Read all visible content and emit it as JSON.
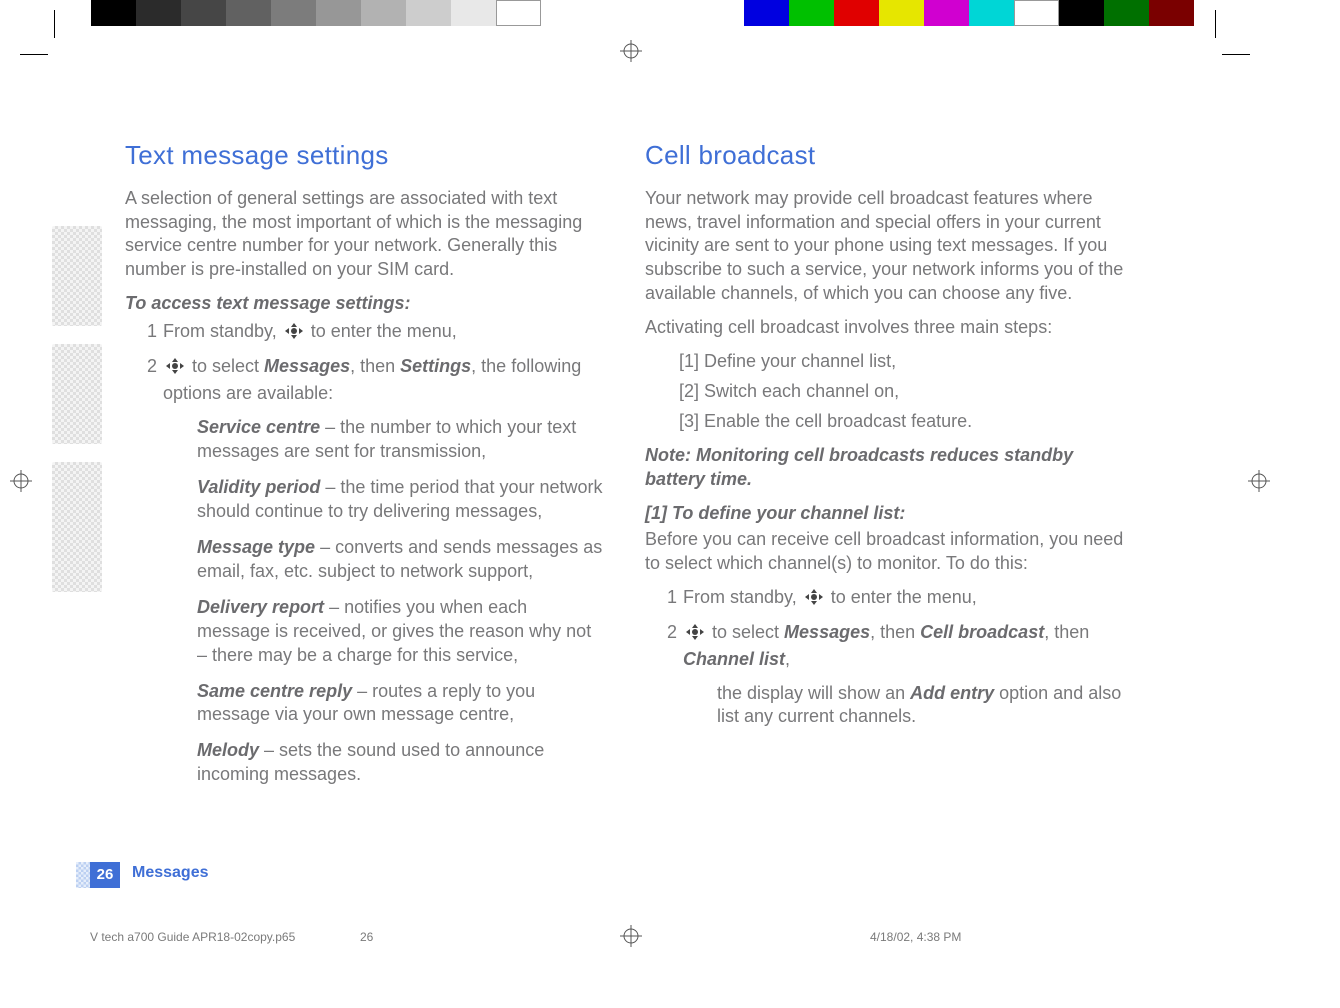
{
  "left": {
    "heading": "Text message settings",
    "intro": "A selection of general settings are associated with text messaging, the most important of which is the messaging service centre number for your network. Generally this number is pre-installed on your SIM card.",
    "access_label": "To access text message settings:",
    "step1_a": "From standby, ",
    "step1_b": " to enter the menu,",
    "step2_a": " to select ",
    "step2_m": "Messages",
    "step2_b": ", then ",
    "step2_s": "Settings",
    "step2_c": ", the following options are available:",
    "opts": [
      {
        "term": "Service centre",
        "desc": " – the number to which your text messages are sent for transmission,"
      },
      {
        "term": "Validity period",
        "desc": " – the time period that your network should continue to try delivering messages,"
      },
      {
        "term": "Message type",
        "desc": " – converts and sends messages as email, fax, etc. subject to network support,"
      },
      {
        "term": "Delivery report",
        "desc": " – notifies you when each message is received, or gives the reason why not – there may be a charge for this service,"
      },
      {
        "term": "Same centre reply",
        "desc": " – routes a reply to you message via your own message centre,"
      },
      {
        "term": "Melody",
        "desc": " – sets the sound used to announce incoming messages."
      }
    ]
  },
  "right": {
    "heading": "Cell broadcast",
    "intro": "Your network may provide cell broadcast features where news, travel information and special offers in your current vicinity are sent to your phone using text messages. If you subscribe to such a service, your network informs you of the available channels, of which you can choose any five.",
    "activating": "Activating cell broadcast involves three main steps:",
    "mains": [
      "[1] Define your channel list,",
      "[2] Switch each channel on,",
      "[3] Enable the cell broadcast feature."
    ],
    "note": "Note: Monitoring cell broadcasts reduces standby battery time.",
    "def_label": "[1] To define your channel list:",
    "def_intro": "Before you can receive cell broadcast information, you need to select which channel(s) to monitor. To do this:",
    "step1_a": "From standby, ",
    "step1_b": " to enter the menu,",
    "step2_a": " to select ",
    "step2_m": "Messages",
    "step2_b": ", then ",
    "step2_c": "Cell broadcast",
    "step2_d": ", then ",
    "step2_e": "Channel list",
    "step2_f": ",",
    "sub_a": "the display will show an ",
    "sub_b": "Add entry",
    "sub_c": " option and also list any current channels."
  },
  "footer": {
    "page": "26",
    "section": "Messages",
    "file": "V tech a700 Guide APR18-02copy.p65",
    "pnum": "26",
    "stamp": "4/18/02, 4:38 PM"
  },
  "colors": {
    "grays": [
      "#000000",
      "#2b2b2b",
      "#464646",
      "#616161",
      "#7c7c7c",
      "#979797",
      "#b2b2b2",
      "#cdcdcd",
      "#e8e8e8",
      "#ffffff"
    ],
    "hues": [
      "#0000e0",
      "#00c000",
      "#e00000",
      "#e6e600",
      "#d000d0",
      "#00d6d6",
      "#ffffff",
      "#000000",
      "#007000",
      "#7a0000"
    ]
  }
}
